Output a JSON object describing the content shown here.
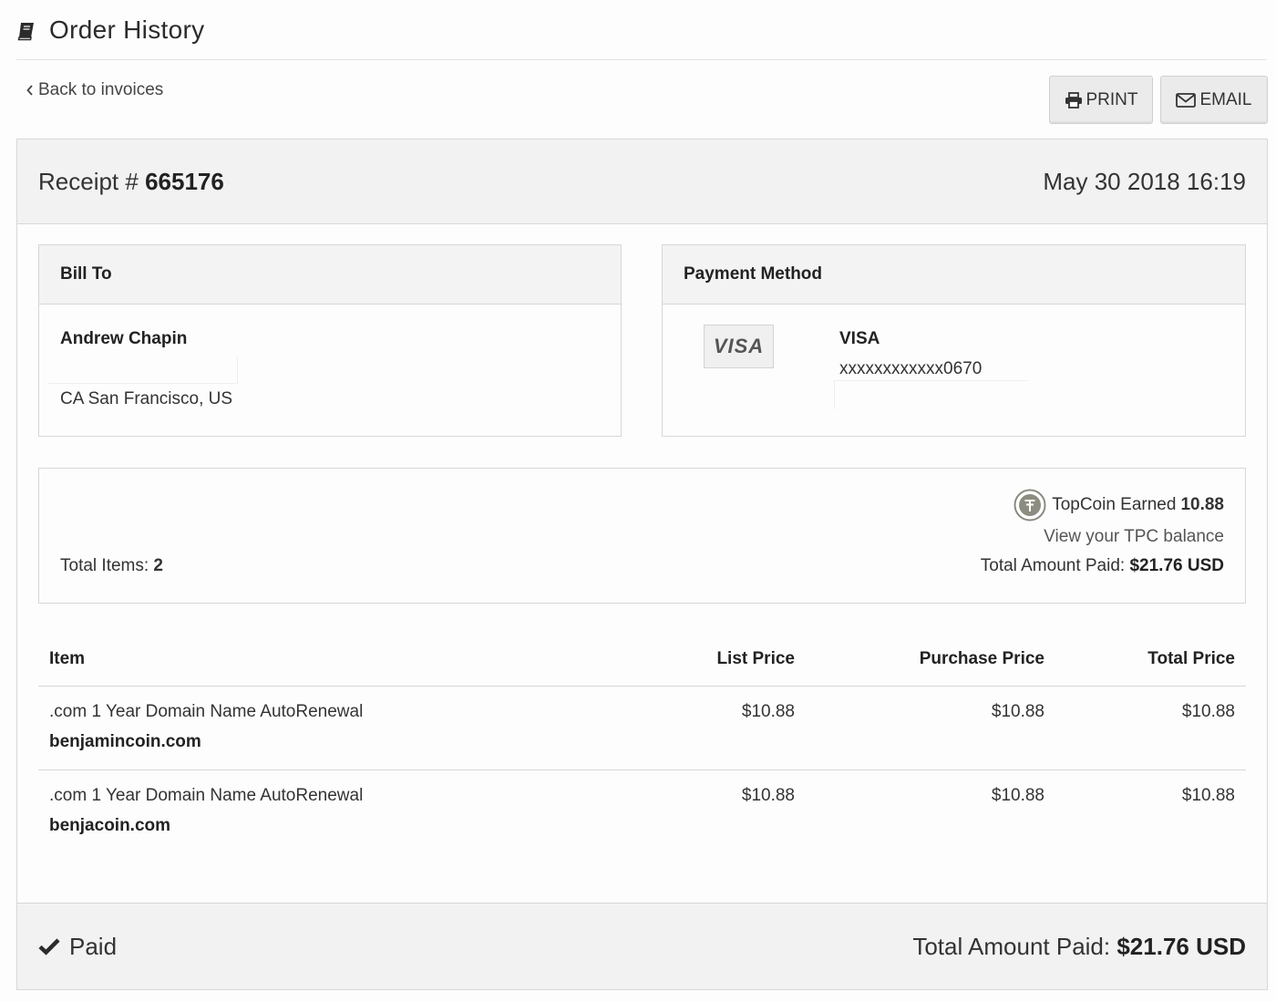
{
  "header": {
    "title": "Order History",
    "icon": "book-icon"
  },
  "nav": {
    "back_label": "Back to invoices"
  },
  "toolbar": {
    "print_label": "PRINT",
    "email_label": "EMAIL"
  },
  "receipt": {
    "label": "Receipt # ",
    "number": "665176",
    "date": "May 30 2018 16:19"
  },
  "bill_to": {
    "heading": "Bill To",
    "name": "Andrew Chapin",
    "address": "CA San Francisco, US"
  },
  "payment": {
    "heading": "Payment Method",
    "logo_text": "VISA",
    "card_type": "VISA",
    "card_number": "xxxxxxxxxxxx0670"
  },
  "summary": {
    "total_items_label": "Total Items: ",
    "total_items": "2",
    "topcoin_label": "TopCoin Earned",
    "topcoin_value": "10.88",
    "tpc_link": "View your TPC balance",
    "amount_label": "Total Amount Paid: ",
    "amount_value": "$21.76 USD"
  },
  "table": {
    "headers": {
      "item": "Item",
      "list": "List Price",
      "purchase": "Purchase Price",
      "total": "Total Price"
    },
    "rows": [
      {
        "desc": ".com 1 Year Domain Name AutoRenewal",
        "domain": "benjamincoin.com",
        "list": "$10.88",
        "purchase": "$10.88",
        "total": "$10.88"
      },
      {
        "desc": ".com 1 Year Domain Name AutoRenewal",
        "domain": "benjacoin.com",
        "list": "$10.88",
        "purchase": "$10.88",
        "total": "$10.88"
      }
    ]
  },
  "footer": {
    "status": "Paid",
    "total_label": "Total Amount Paid: ",
    "total_value": "$21.76 USD"
  },
  "colors": {
    "panel_bg": "#f2f2f2",
    "border": "#d7d7d7",
    "button_bg": "#ebebeb",
    "text": "#2b2b2b"
  }
}
